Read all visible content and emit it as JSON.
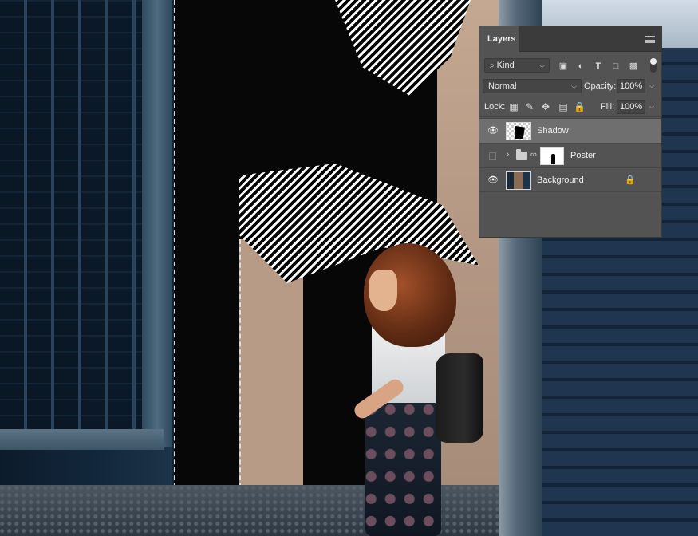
{
  "panel": {
    "tab_title": "Layers",
    "filter": {
      "kind_label": "Kind",
      "icons": [
        "image-filter-icon",
        "adjustment-filter-icon",
        "type-filter-icon",
        "shape-filter-icon",
        "smart-object-filter-icon"
      ]
    },
    "blend_mode": "Normal",
    "opacity_label": "Opacity:",
    "opacity_value": "100%",
    "lock_label": "Lock:",
    "lock_icons": [
      "lock-transparent-pixels-icon",
      "lock-image-pixels-icon",
      "lock-position-icon",
      "lock-artboard-icon",
      "lock-all-icon"
    ],
    "fill_label": "Fill:",
    "fill_value": "100%"
  },
  "layers": [
    {
      "name": "Shadow",
      "visible": true,
      "selected": true,
      "type": "pixel"
    },
    {
      "name": "Poster",
      "visible": false,
      "selected": false,
      "type": "group-with-mask"
    },
    {
      "name": "Background",
      "visible": true,
      "selected": false,
      "type": "locked-background"
    }
  ],
  "colors": {
    "panel_bg": "#535353",
    "selected_row": "#6f6f6f",
    "tab_bar": "#3b3b3b"
  }
}
